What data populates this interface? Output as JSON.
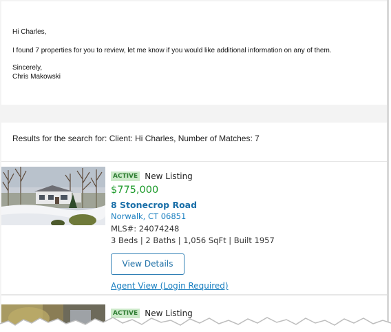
{
  "email": {
    "greeting": "Hi Charles,",
    "body": "I found 7 properties for you to review, let me know if you would like additional information on any of them.",
    "closing": "Sincerely,",
    "signature": "Chris Makowski"
  },
  "results": {
    "header": "Results for the search for: Client: Hi Charles, Number of Matches: 7"
  },
  "listings": [
    {
      "badge": "ACTIVE",
      "status": "New Listing",
      "price": "$775,000",
      "address": "8 Stonecrop Road",
      "city": "Norwalk, CT 06851",
      "mls": "MLS#: 24074248",
      "details": "3 Beds | 2 Baths | 1,056 SqFt | Built 1957",
      "view_details_label": "View Details",
      "agent_view_label": "Agent View (Login Required)",
      "photo": "house-snow-photo"
    },
    {
      "badge": "ACTIVE",
      "status": "New Listing",
      "photo": "house-photo"
    }
  ],
  "colors": {
    "price_green": "#1c9a2a",
    "badge_bg": "#cce9c9",
    "badge_text": "#2e7d32",
    "link_blue": "#1a7fc0",
    "button_border": "#2f7fb5"
  }
}
